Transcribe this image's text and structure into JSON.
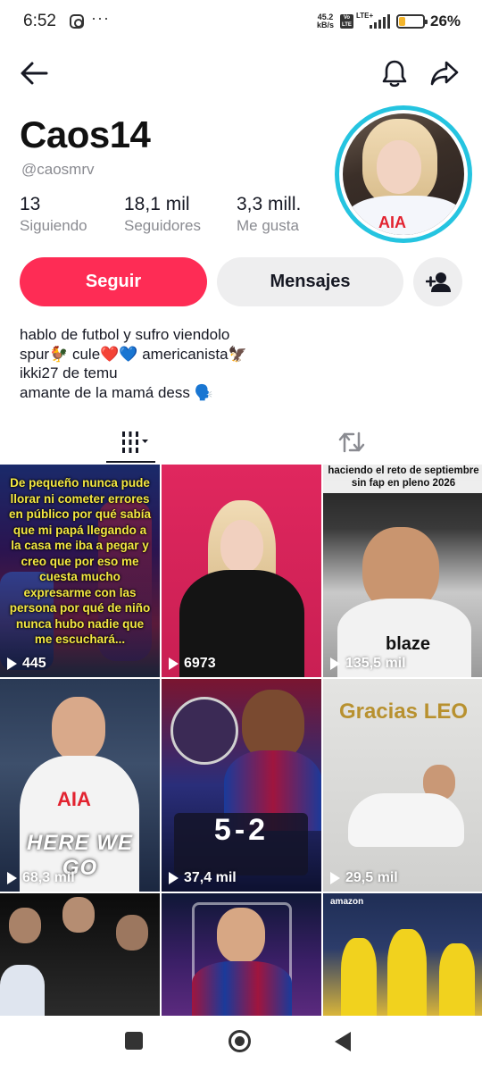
{
  "status_bar": {
    "time": "6:52",
    "dots": "···",
    "net_speed_value": "45.2",
    "net_speed_unit": "kB/s",
    "volte": "Vo LTE",
    "lte": "LTE+",
    "battery_percent": 26,
    "battery_label": "26%",
    "battery_color": "#f3b52c"
  },
  "header": {
    "back_icon": "arrow-left-icon",
    "bell_icon": "bell-icon",
    "share_icon": "share-arrow-icon"
  },
  "profile": {
    "display_name": "Caos14",
    "handle": "@caosmrv",
    "ring_color": "#25c4e0",
    "avatar_text": "AIA",
    "stats": [
      {
        "value": "13",
        "label": "Siguiendo"
      },
      {
        "value": "18,1 mil",
        "label": "Seguidores"
      },
      {
        "value": "3,3 mill.",
        "label": "Me gusta"
      }
    ],
    "bio_lines": [
      "hablo de futbol y sufro viendolo",
      "spur🐓 cule❤️💙 americanista🦅",
      "ikki27 de temu",
      "amante de la mamá dess 🗣️"
    ]
  },
  "actions": {
    "follow_label": "Seguir",
    "follow_color": "#fe2c55",
    "message_label": "Mensajes",
    "add_friend_icon": "add-user-icon"
  },
  "tabs": {
    "videos_icon": "grid-videos-icon",
    "reposts_icon": "repost-icon"
  },
  "videos": [
    {
      "views": "445",
      "caption": "De pequeño nunca pude llorar ni cometer errores en público por qué sabía que mi papá llegando a la casa me iba a pegar y creo que por eso me cuesta mucho expresarme con las persona por qué de niño nunca hubo nadie que me escuchará..."
    },
    {
      "views": "6973",
      "caption": ""
    },
    {
      "views": "135,5 mil",
      "caption": "haciendo el reto de septiembre sin fap en pleno 2026"
    },
    {
      "views": "68,3 mil",
      "caption": "HERE WE GO"
    },
    {
      "views": "37,4 mil",
      "caption": "5-2"
    },
    {
      "views": "29,5 mil",
      "caption": "Gracias LEO"
    },
    {
      "views": "",
      "caption": ""
    },
    {
      "views": "",
      "caption": ""
    },
    {
      "views": "",
      "caption": "amazon"
    }
  ],
  "navbar": {
    "recent_icon": "square-recent-icon",
    "home_icon": "circle-home-icon",
    "back_icon": "triangle-back-icon"
  }
}
